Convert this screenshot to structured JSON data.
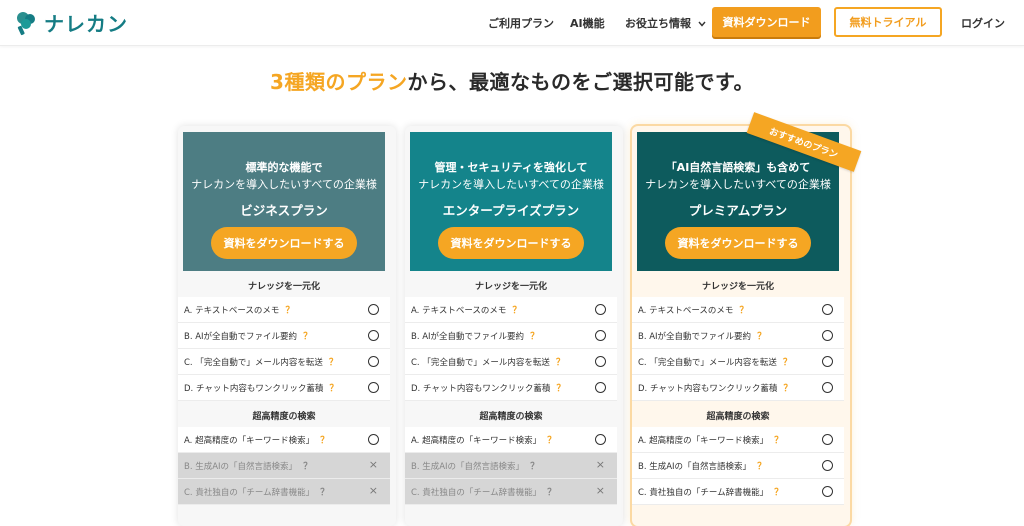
{
  "header": {
    "logo_text": "ナレカン",
    "nav": [
      "ご利用プラン",
      "AI機能",
      "お役立ち情報"
    ],
    "download_label": "資料ダウンロード",
    "trial_label": "無料トライアル",
    "login_label": "ログイン"
  },
  "headline": {
    "highlight": "3種類のプラン",
    "rest": "から、最適なものをご選択可能です。"
  },
  "ribbon": "おすすめのプラン",
  "colors": {
    "accent": "#f5a623",
    "business": "#4d7d83",
    "enterprise": "#14848b",
    "premium": "#0d5b5d"
  },
  "sections": [
    "ナレッジを一元化",
    "超高精度の検索"
  ],
  "features_a": [
    "A. テキストベースのメモ",
    "B. AIが全自動でファイル要約",
    "C. 「完全自動で」メール内容を転送",
    "D. チャット内容もワンクリック蓄積"
  ],
  "features_b": [
    "A. 超高精度の「キーワード検索」",
    "B. 生成AIの「自然言語検索」",
    "C. 貴社独自の「チーム辞書機能」"
  ],
  "q_mark": "？",
  "x_mark": "×",
  "plans": [
    {
      "line1": "標準的な機能で",
      "line2": "ナレカンを導入したいすべての企業様",
      "name": "ビジネスプラン",
      "button": "資料をダウンロードする",
      "availability_b": [
        true,
        false,
        false
      ]
    },
    {
      "line1": "管理・セキュリティを強化して",
      "line2": "ナレカンを導入したいすべての企業様",
      "name": "エンタープライズプラン",
      "button": "資料をダウンロードする",
      "availability_b": [
        true,
        false,
        false
      ]
    },
    {
      "line1": "「AI自然言語検索」も含めて",
      "line2": "ナレカンを導入したいすべての企業様",
      "name": "プレミアムプラン",
      "button": "資料をダウンロードする",
      "availability_b": [
        true,
        true,
        true
      ]
    }
  ]
}
